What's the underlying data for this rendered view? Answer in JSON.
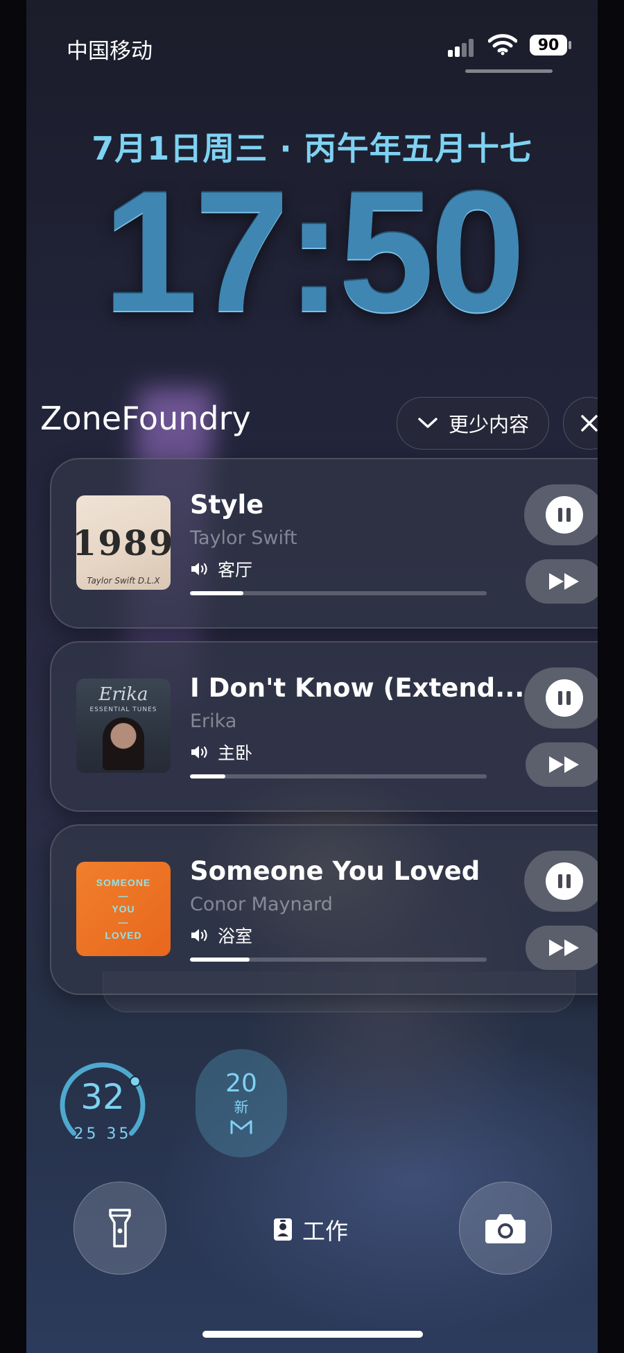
{
  "status_bar": {
    "carrier": "中国移动",
    "battery": "90",
    "signal_icon": "cellular-signal-icon",
    "wifi_icon": "wifi-icon"
  },
  "lockscreen": {
    "date": "7月1日周三 · 丙午年五月十七",
    "time": "17:50"
  },
  "widget_header": {
    "app_name": "ZoneFoundry",
    "less_label": "更少内容",
    "less_icon": "chevron-down-icon",
    "close_icon": "close-icon"
  },
  "now_playing": [
    {
      "title": "Style",
      "artist": "Taylor Swift",
      "room": "客厅",
      "progress": 0.18,
      "art": {
        "main": "1989",
        "caption": "Taylor Swift  D.L.X"
      }
    },
    {
      "title": "I Don't Know (Extend...",
      "artist": "Erika",
      "room": "主卧",
      "progress": 0.12,
      "art": {
        "main": "Erika",
        "caption": "ESSENTIAL TUNES"
      }
    },
    {
      "title": "Someone You Loved",
      "artist": "Conor Maynard",
      "room": "浴室",
      "progress": 0.2,
      "art": {
        "line1": "SOMEONE",
        "sep1": "—",
        "line2": "YOU",
        "sep2": "—",
        "line3": "LOVED"
      }
    }
  ],
  "widgets": {
    "weather": {
      "temp": "32",
      "low": "25",
      "high": "35",
      "gauge": 0.7
    },
    "mail": {
      "count": "20",
      "label": "新",
      "icon": "mail-m-icon"
    }
  },
  "bottom": {
    "focus_label": "工作",
    "focus_icon": "id-badge-icon",
    "flashlight_icon": "flashlight-icon",
    "camera_icon": "camera-icon"
  },
  "colors": {
    "accent": "#7ed2f2",
    "clock": "#3f86b2"
  }
}
